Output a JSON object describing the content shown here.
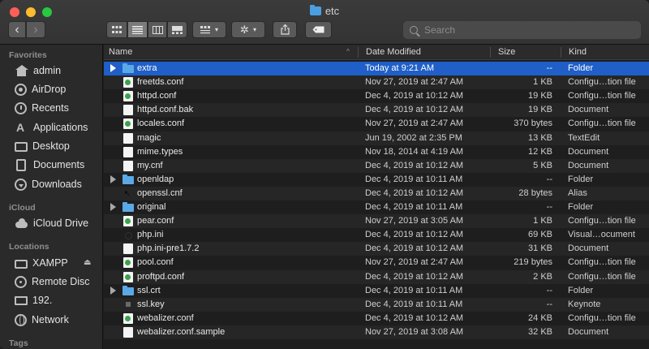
{
  "window": {
    "title": "etc"
  },
  "toolbar": {
    "back_glyph": "‹",
    "forward_glyph": "›",
    "view_icons": [
      "icon-view-icon",
      "list-view-icon",
      "column-view-icon",
      "gallery-view-icon"
    ],
    "group_glyph": "▦",
    "action_glyph": "✲",
    "share_glyph": "⇧",
    "tag_glyph": "⬭",
    "search_placeholder": "Search"
  },
  "sidebar": {
    "favorites_header": "Favorites",
    "favorites": [
      {
        "label": "admin",
        "icon": "home-icon"
      },
      {
        "label": "AirDrop",
        "icon": "airdrop-icon"
      },
      {
        "label": "Recents",
        "icon": "recents-icon"
      },
      {
        "label": "Applications",
        "icon": "applications-icon"
      },
      {
        "label": "Desktop",
        "icon": "desktop-icon"
      },
      {
        "label": "Documents",
        "icon": "documents-icon"
      },
      {
        "label": "Downloads",
        "icon": "downloads-icon"
      }
    ],
    "icloud_header": "iCloud",
    "icloud": [
      {
        "label": "iCloud Drive",
        "icon": "cloud-icon"
      }
    ],
    "locations_header": "Locations",
    "locations": [
      {
        "label": "XAMPP",
        "icon": "drive-icon"
      },
      {
        "label": "Remote Disc",
        "icon": "disc-icon"
      },
      {
        "label": "192.",
        "icon": "monitor-icon"
      },
      {
        "label": "Network",
        "icon": "network-icon"
      }
    ],
    "tags_header": "Tags"
  },
  "columns": {
    "name": "Name",
    "date": "Date Modified",
    "size": "Size",
    "kind": "Kind"
  },
  "files": [
    {
      "name": "extra",
      "date": "Today at 9:21 AM",
      "size": "--",
      "kind": "Folder",
      "type": "folder",
      "selected": true
    },
    {
      "name": "freetds.conf",
      "date": "Nov 27, 2019 at 2:47 AM",
      "size": "1 KB",
      "kind": "Configu…tion file",
      "type": "conf"
    },
    {
      "name": "httpd.conf",
      "date": "Dec 4, 2019 at 10:12 AM",
      "size": "19 KB",
      "kind": "Configu…tion file",
      "type": "conf"
    },
    {
      "name": "httpd.conf.bak",
      "date": "Dec 4, 2019 at 10:12 AM",
      "size": "19 KB",
      "kind": "Document",
      "type": "doc"
    },
    {
      "name": "locales.conf",
      "date": "Nov 27, 2019 at 2:47 AM",
      "size": "370 bytes",
      "kind": "Configu…tion file",
      "type": "conf"
    },
    {
      "name": "magic",
      "date": "Jun 19, 2002 at 2:35 PM",
      "size": "13 KB",
      "kind": "TextEdit",
      "type": "doc"
    },
    {
      "name": "mime.types",
      "date": "Nov 18, 2014 at 4:19 AM",
      "size": "12 KB",
      "kind": "Document",
      "type": "doc"
    },
    {
      "name": "my.cnf",
      "date": "Dec 4, 2019 at 10:12 AM",
      "size": "5 KB",
      "kind": "Document",
      "type": "doc"
    },
    {
      "name": "openldap",
      "date": "Dec 4, 2019 at 10:11 AM",
      "size": "--",
      "kind": "Folder",
      "type": "folder"
    },
    {
      "name": "openssl.cnf",
      "date": "Dec 4, 2019 at 10:12 AM",
      "size": "28 bytes",
      "kind": "Alias",
      "type": "alias"
    },
    {
      "name": "original",
      "date": "Dec 4, 2019 at 10:11 AM",
      "size": "--",
      "kind": "Folder",
      "type": "folder"
    },
    {
      "name": "pear.conf",
      "date": "Nov 27, 2019 at 3:05 AM",
      "size": "1 KB",
      "kind": "Configu…tion file",
      "type": "conf"
    },
    {
      "name": "php.ini",
      "date": "Dec 4, 2019 at 10:12 AM",
      "size": "69 KB",
      "kind": "Visual…ocument",
      "type": "php"
    },
    {
      "name": "php.ini-pre1.7.2",
      "date": "Dec 4, 2019 at 10:12 AM",
      "size": "31 KB",
      "kind": "Document",
      "type": "doc"
    },
    {
      "name": "pool.conf",
      "date": "Nov 27, 2019 at 2:47 AM",
      "size": "219 bytes",
      "kind": "Configu…tion file",
      "type": "conf"
    },
    {
      "name": "proftpd.conf",
      "date": "Dec 4, 2019 at 10:12 AM",
      "size": "2 KB",
      "kind": "Configu…tion file",
      "type": "conf"
    },
    {
      "name": "ssl.crt",
      "date": "Dec 4, 2019 at 10:11 AM",
      "size": "--",
      "kind": "Folder",
      "type": "folder"
    },
    {
      "name": "ssl.key",
      "date": "Dec 4, 2019 at 10:11 AM",
      "size": "--",
      "kind": "Keynote",
      "type": "keynote"
    },
    {
      "name": "webalizer.conf",
      "date": "Dec 4, 2019 at 10:12 AM",
      "size": "24 KB",
      "kind": "Configu…tion file",
      "type": "conf"
    },
    {
      "name": "webalizer.conf.sample",
      "date": "Nov 27, 2019 at 3:08 AM",
      "size": "32 KB",
      "kind": "Document",
      "type": "doc"
    }
  ]
}
